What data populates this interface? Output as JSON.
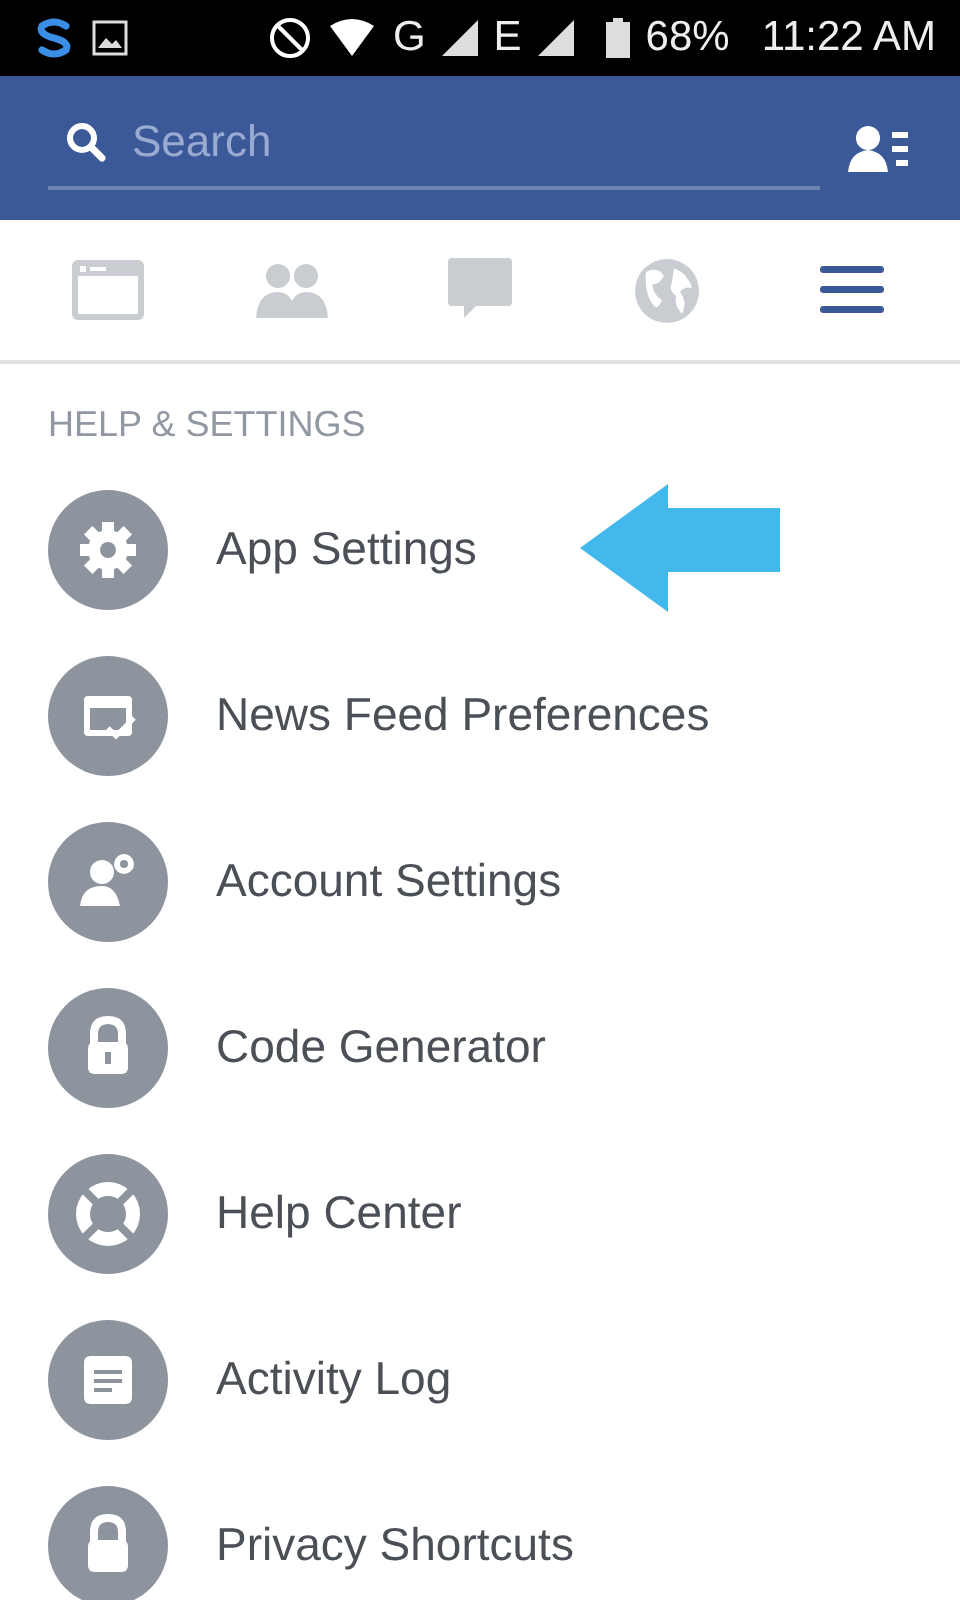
{
  "status_bar": {
    "network_1": "G",
    "network_2": "E",
    "battery": "68%",
    "time": "11:22 AM"
  },
  "search": {
    "placeholder": "Search"
  },
  "tabs": [
    {
      "kind": "feed",
      "selected": false
    },
    {
      "kind": "friends",
      "selected": false
    },
    {
      "kind": "messages",
      "selected": false
    },
    {
      "kind": "globe",
      "selected": false
    },
    {
      "kind": "menu",
      "selected": true
    }
  ],
  "section": {
    "title": "HELP & SETTINGS"
  },
  "items": [
    {
      "kind": "gear",
      "label": "App Settings",
      "highlighted": true
    },
    {
      "kind": "feed",
      "label": "News Feed Preferences",
      "highlighted": false
    },
    {
      "kind": "account",
      "label": "Account Settings",
      "highlighted": false
    },
    {
      "kind": "code",
      "label": "Code Generator",
      "highlighted": false
    },
    {
      "kind": "help",
      "label": "Help Center",
      "highlighted": false
    },
    {
      "kind": "log",
      "label": "Activity Log",
      "highlighted": false
    },
    {
      "kind": "lock",
      "label": "Privacy Shortcuts",
      "highlighted": false
    }
  ]
}
